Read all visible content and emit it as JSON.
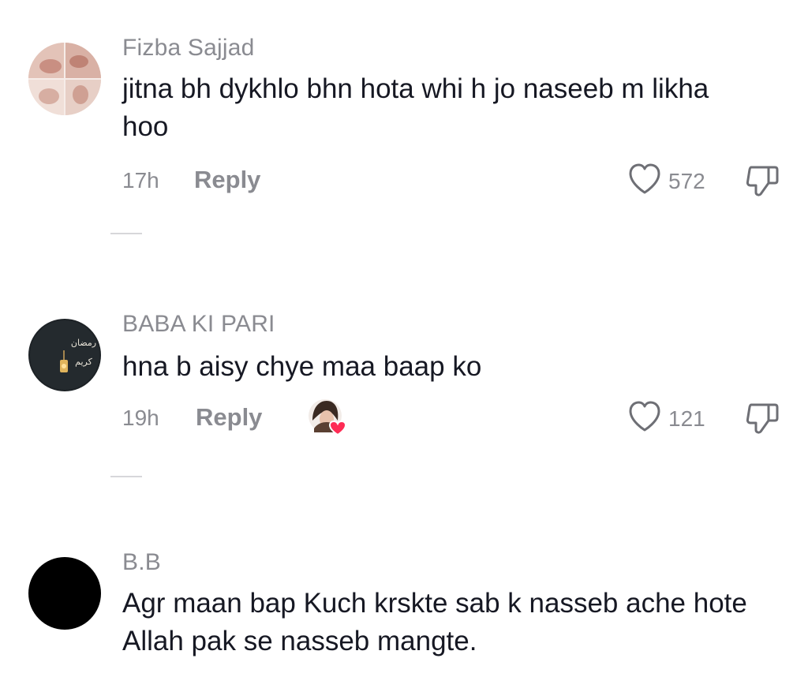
{
  "comments": [
    {
      "username": "Fizba Sajjad",
      "text": "jitna bh dykhlo bhn hota whi h jo naseeb m likha hoo",
      "time": "17h",
      "reply_label": "Reply",
      "likes": "572",
      "avatar": "photo-collage"
    },
    {
      "username": "BABA KI PARI",
      "text": "hna b aisy chye maa baap ko",
      "time": "19h",
      "reply_label": "Reply",
      "likes": "121",
      "avatar": "ramadan-lantern",
      "creator_liked": true
    },
    {
      "username": "B.B",
      "text": "Agr maan bap Kuch krskte sab k nasseb ache hote Allah pak se nasseb mangte.",
      "avatar": "black-circle"
    }
  ],
  "colors": {
    "muted_text": "#8a8b91",
    "primary_text": "#161823",
    "heart_red": "#fe2c55"
  }
}
